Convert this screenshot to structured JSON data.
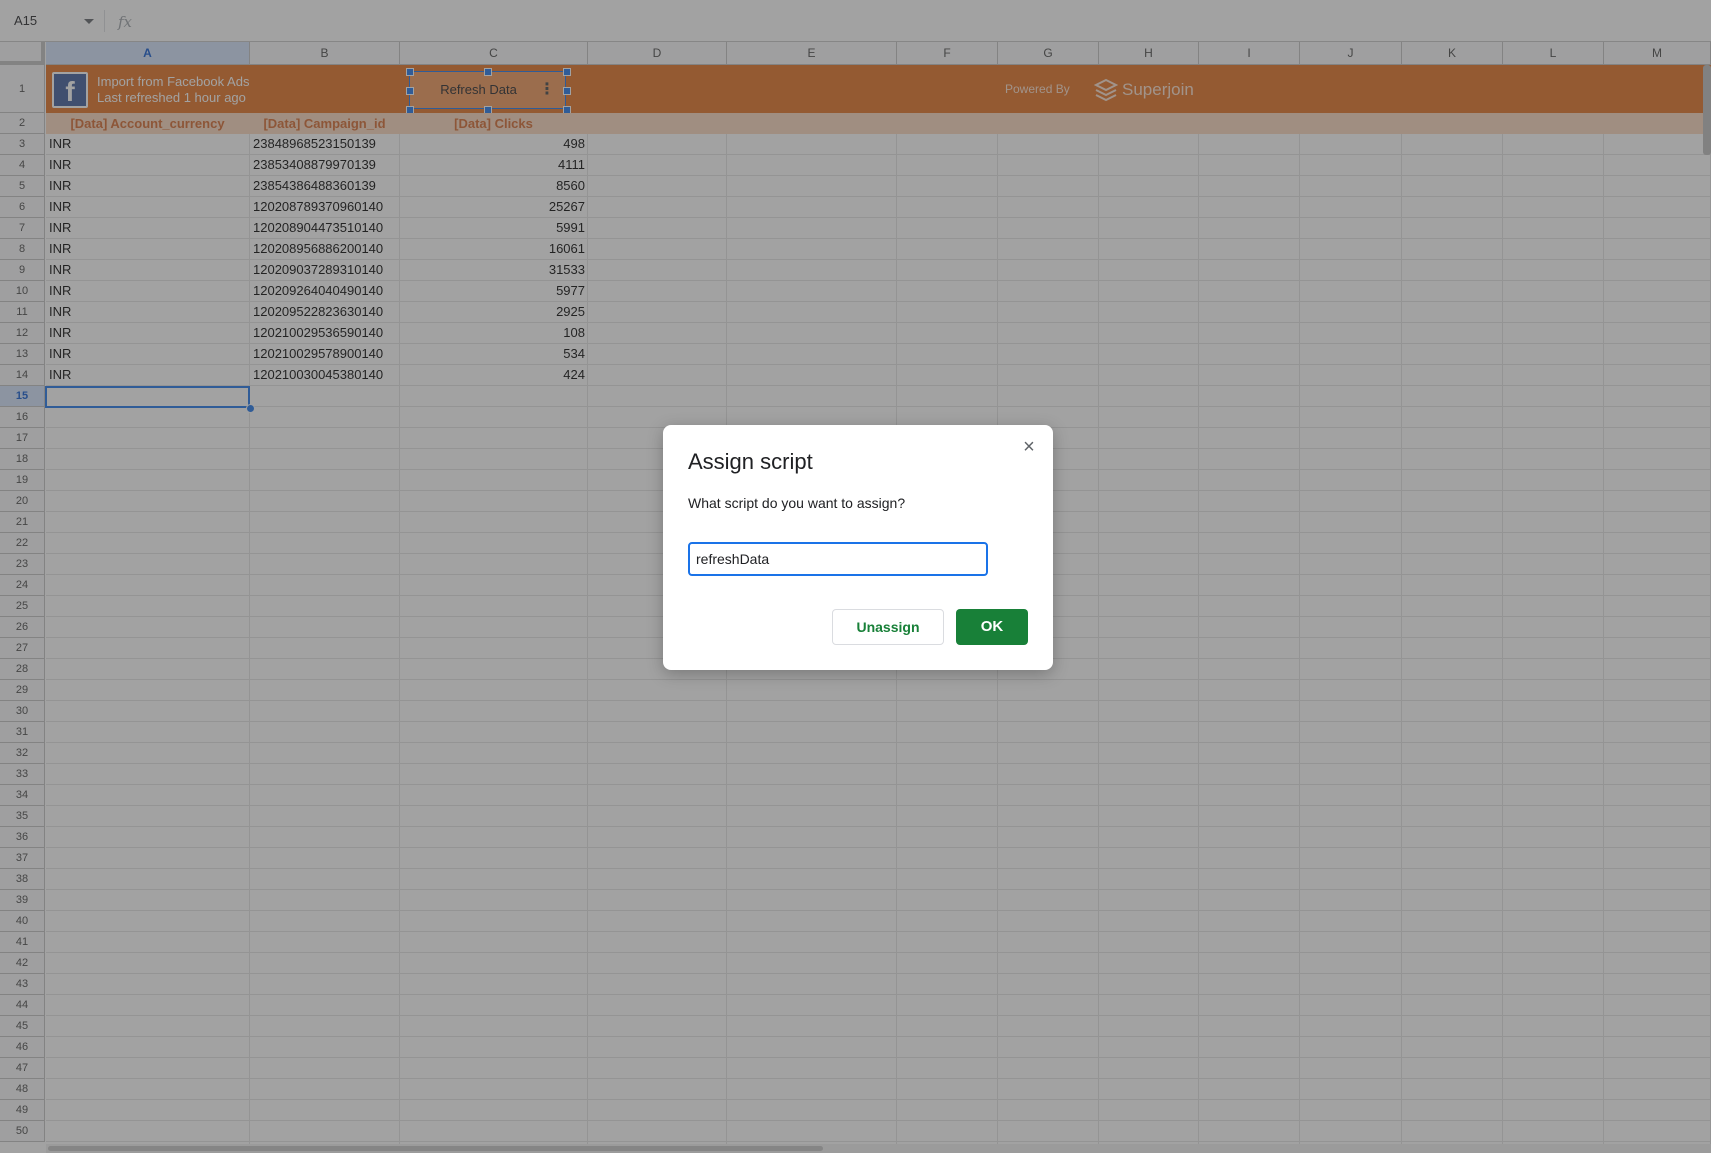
{
  "formula_bar": {
    "name_box": "A15",
    "fx_label": "fx",
    "formula": ""
  },
  "columns": [
    "A",
    "B",
    "C",
    "D",
    "E",
    "F",
    "G",
    "H",
    "I",
    "J",
    "K",
    "L",
    "M"
  ],
  "rows": [
    "1",
    "2",
    "3",
    "4",
    "5",
    "6",
    "7",
    "8",
    "9",
    "10",
    "11",
    "12",
    "13",
    "14",
    "15",
    "16",
    "17",
    "18",
    "19",
    "20",
    "21",
    "22",
    "23",
    "24",
    "25",
    "26",
    "27",
    "28",
    "29",
    "30",
    "31",
    "32",
    "33",
    "34",
    "35",
    "36",
    "37",
    "38",
    "39",
    "40",
    "41",
    "42",
    "43",
    "44",
    "45",
    "46",
    "47",
    "48",
    "49",
    "50"
  ],
  "selected": {
    "column": "A",
    "row": "15"
  },
  "banner": {
    "line1": "Import from Facebook Ads",
    "line2": "Last refreshed 1 hour ago",
    "refresh_button": "Refresh Data",
    "powered_by": "Powered By",
    "brand": "Superjoin",
    "color": "#e36e1e"
  },
  "table": {
    "headers": [
      "[Data] Account_currency",
      "[Data] Campaign_id",
      "[Data] Clicks"
    ],
    "rows": [
      [
        "INR",
        "23848968523150139",
        "498"
      ],
      [
        "INR",
        "23853408879970139",
        "4111"
      ],
      [
        "INR",
        "23854386488360139",
        "8560"
      ],
      [
        "INR",
        "120208789370960140",
        "25267"
      ],
      [
        "INR",
        "120208904473510140",
        "5991"
      ],
      [
        "INR",
        "120208956886200140",
        "16061"
      ],
      [
        "INR",
        "120209037289310140",
        "31533"
      ],
      [
        "INR",
        "120209264040490140",
        "5977"
      ],
      [
        "INR",
        "120209522823630140",
        "2925"
      ],
      [
        "INR",
        "120210029536590140",
        "108"
      ],
      [
        "INR",
        "120210029578900140",
        "534"
      ],
      [
        "INR",
        "120210030045380140",
        "424"
      ]
    ]
  },
  "dialog": {
    "title": "Assign script",
    "question": "What script do you want to assign?",
    "input_value": "refreshData",
    "unassign_label": "Unassign",
    "ok_label": "OK",
    "close_icon": "×"
  }
}
